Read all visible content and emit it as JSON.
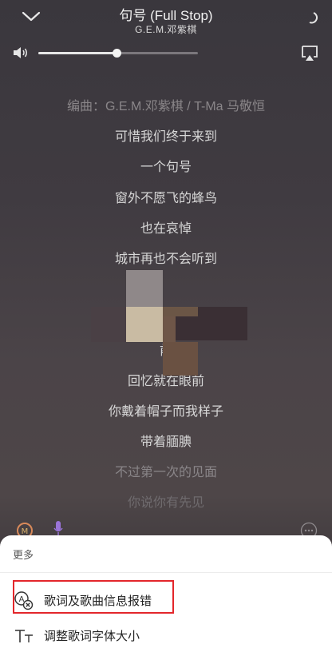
{
  "header": {
    "song_title": "句号 (Full Stop)",
    "artist": "G.E.M.邓紫棋",
    "volume_level": 0.49
  },
  "lyrics": [
    {
      "text": "编曲：G.E.M.邓紫棋 / T-Ma 马敬恒",
      "style": "dim"
    },
    {
      "text": "可惜我们终于来到",
      "style": "normal"
    },
    {
      "text": "一个句号",
      "style": "normal"
    },
    {
      "text": "窗外不愿飞的蜂鸟",
      "style": "normal"
    },
    {
      "text": "也在哀悼",
      "style": "normal"
    },
    {
      "text": "城市再也不会听到",
      "style": "normal"
    },
    {
      "text": "",
      "style": "normal"
    },
    {
      "text": "",
      "style": "normal"
    },
    {
      "text": "前",
      "style": "normal"
    },
    {
      "text": "回忆就在眼前",
      "style": "normal"
    },
    {
      "text": "你戴着帽子而我样子",
      "style": "normal"
    },
    {
      "text": "带着腼腆",
      "style": "normal"
    },
    {
      "text": "不过第一次的见面",
      "style": "dim"
    },
    {
      "text": "你说你有先见",
      "style": "faded"
    }
  ],
  "sheet": {
    "title": "更多",
    "items": [
      {
        "label": "歌词及歌曲信息报错",
        "icon": "report-error-icon"
      },
      {
        "label": "调整歌词字体大小",
        "icon": "font-size-icon"
      }
    ],
    "highlight_color": "#e3262b"
  }
}
